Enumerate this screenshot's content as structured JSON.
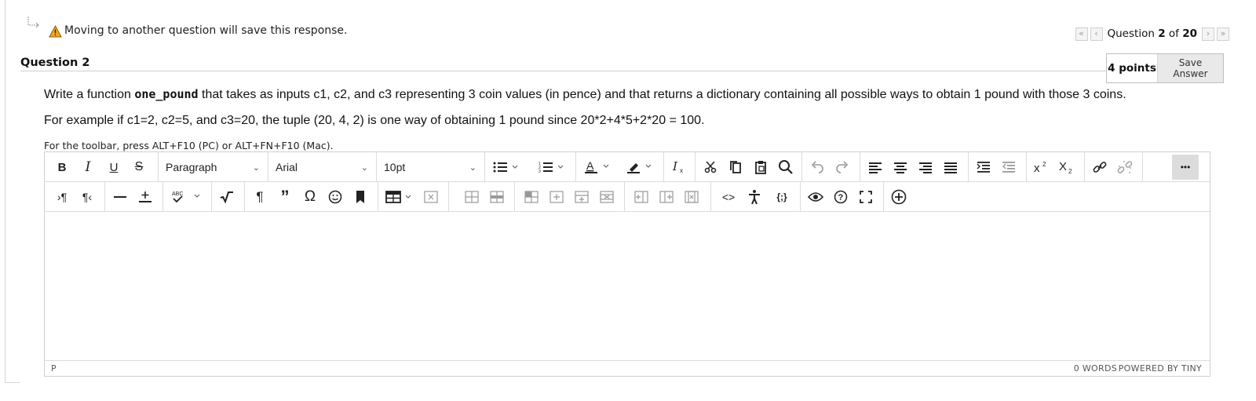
{
  "notice": {
    "text": "Moving to another question will save this response."
  },
  "nav": {
    "prefix": "Question",
    "current": "2",
    "of": "of",
    "total": "20",
    "first_label": "«",
    "prev_label": "‹",
    "next_label": "›",
    "last_label": "»"
  },
  "question": {
    "title": "Question 2",
    "points": "4 points",
    "save_label": "Save Answer",
    "para1_a": "Write a function ",
    "para1_code": "one_pound",
    "para1_b": " that takes as inputs c1, c2, and c3 representing 3 coin values (in pence) and that returns a dictionary containing all possible ways to obtain 1 pound with those 3 coins.",
    "para2": "For example if c1=2, c2=5, and c3=20, the tuple (20, 4, 2) is one way of obtaining 1 pound since 20*2+4*5+2*20 = 100."
  },
  "editor": {
    "hint": "For the toolbar, press ALT+F10 (PC) or ALT+FN+F10 (Mac).",
    "block_format": "Paragraph",
    "font_family": "Arial",
    "font_size": "10pt",
    "bold": "B",
    "italic": "I",
    "underline": "U",
    "strike": "S",
    "more": "•••",
    "status_path": "P",
    "word_count": "0 WORDS",
    "powered_by": "POWERED BY TINY",
    "accent_color": "#111111"
  }
}
